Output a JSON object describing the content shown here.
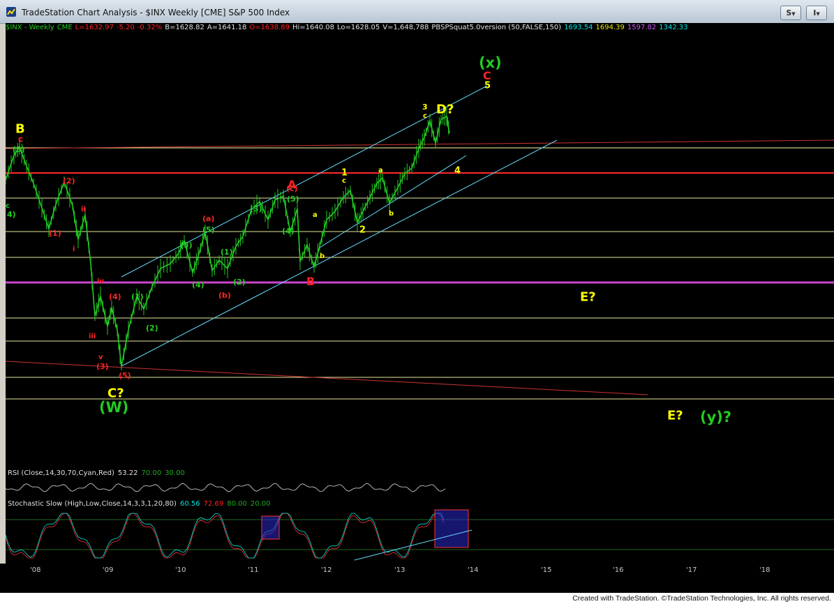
{
  "window": {
    "title": "TradeStation Chart Analysis - $INX Weekly [CME] S&P 500 Index",
    "buttons": [
      {
        "label": "S"
      },
      {
        "label": "I"
      }
    ]
  },
  "status_bar": {
    "symbol": "$INX - Weekly",
    "exchange": "CME",
    "last": "L=1632.97",
    "change": "-5.20",
    "pct_change": "-0.32%",
    "bid": "B=1628.82",
    "ask": "A=1641.18",
    "open": "O=1638.89",
    "high": "Hi=1640.08",
    "low": "Lo=1628.05",
    "volume": "V=1,648,788",
    "indicator": "PBSPSquat5.0version (50,FALSE,150)",
    "values": [
      "1693.54",
      "1694.39",
      "1597.82",
      "1342.33"
    ],
    "value_colors": [
      "#00e5e5",
      "#e5e500",
      "#cc55ee",
      "#00e5e5"
    ]
  },
  "rsi": {
    "label": "RSI (Close,14,30,70,Cyan,Red)",
    "value": "53.22",
    "upper": "70.00",
    "lower": "30.00"
  },
  "stochastic": {
    "label": "Stochastic Slow (High,Low,Close,14,3,3,1,20,80)",
    "k": "60.56",
    "d": "72.69",
    "upper": "80.00",
    "lower": "20.00"
  },
  "x_axis": {
    "ticks": [
      "'08",
      "'09",
      "'10",
      "'11",
      "'12",
      "'13",
      "'14",
      "'15",
      "'16",
      "'17",
      "'18"
    ]
  },
  "wave_labels": [
    {
      "t": "B",
      "c": "#ffff00",
      "s": 18
    },
    {
      "t": "c",
      "c": "#ff2222",
      "s": 12
    },
    {
      "t": "(5)",
      "c": "#22cc22",
      "s": 11
    },
    {
      "t": "c",
      "c": "#22cc22",
      "s": 10
    },
    {
      "t": "4)",
      "c": "#22cc22",
      "s": 11
    },
    {
      "t": "(2)",
      "c": "#ff2222",
      "s": 11
    },
    {
      "t": "(1)",
      "c": "#ff2222",
      "s": 11
    },
    {
      "t": "ii",
      "c": "#ff2222",
      "s": 10
    },
    {
      "t": "i",
      "c": "#ff2222",
      "s": 10
    },
    {
      "t": "iv",
      "c": "#ff2222",
      "s": 10
    },
    {
      "t": "(4)",
      "c": "#ff2222",
      "s": 11
    },
    {
      "t": "iii",
      "c": "#ff2222",
      "s": 10
    },
    {
      "t": "v",
      "c": "#ff2222",
      "s": 10
    },
    {
      "t": "(3)",
      "c": "#ff2222",
      "s": 11
    },
    {
      "t": "(5)",
      "c": "#ff2222",
      "s": 11
    },
    {
      "t": "C?",
      "c": "#ffff00",
      "s": 18
    },
    {
      "t": "(W)",
      "c": "#22cc22",
      "s": 21
    },
    {
      "t": "(1)",
      "c": "#22cc22",
      "s": 11
    },
    {
      "t": "(2)",
      "c": "#22cc22",
      "s": 11
    },
    {
      "t": "(3)",
      "c": "#22cc22",
      "s": 11
    },
    {
      "t": "(4)",
      "c": "#22cc22",
      "s": 11
    },
    {
      "t": "(a)",
      "c": "#ff2222",
      "s": 11
    },
    {
      "t": "(5)",
      "c": "#22cc22",
      "s": 11
    },
    {
      "t": "(1)",
      "c": "#22cc22",
      "s": 11
    },
    {
      "t": "(b)",
      "c": "#ff2222",
      "s": 11
    },
    {
      "t": "(2)",
      "c": "#22cc22",
      "s": 11
    },
    {
      "t": "(3)",
      "c": "#22cc22",
      "s": 11
    },
    {
      "t": "A",
      "c": "#ff2222",
      "s": 16
    },
    {
      "t": "(c)",
      "c": "#ff2222",
      "s": 11
    },
    {
      "t": "(5)",
      "c": "#22cc22",
      "s": 11
    },
    {
      "t": "(4)",
      "c": "#22cc22",
      "s": 11
    },
    {
      "t": "B",
      "c": "#ff2222",
      "s": 16
    },
    {
      "t": "a",
      "c": "#ffff00",
      "s": 10
    },
    {
      "t": "b",
      "c": "#ffff00",
      "s": 10
    },
    {
      "t": "1",
      "c": "#ffff00",
      "s": 13
    },
    {
      "t": "c",
      "c": "#ffff00",
      "s": 10
    },
    {
      "t": "2",
      "c": "#ffff00",
      "s": 13
    },
    {
      "t": "a",
      "c": "#ffff00",
      "s": 10
    },
    {
      "t": "b",
      "c": "#ffff00",
      "s": 10
    },
    {
      "t": "3",
      "c": "#ffff00",
      "s": 11
    },
    {
      "t": "c",
      "c": "#ffff00",
      "s": 10
    },
    {
      "t": "D?",
      "c": "#ffff00",
      "s": 18
    },
    {
      "t": "4",
      "c": "#ffff00",
      "s": 13
    },
    {
      "t": "5",
      "c": "#ffff00",
      "s": 13
    },
    {
      "t": "C",
      "c": "#ff2222",
      "s": 16
    },
    {
      "t": "(x)",
      "c": "#22cc22",
      "s": 21
    },
    {
      "t": "E?",
      "c": "#ffff00",
      "s": 18
    },
    {
      "t": "E?",
      "c": "#ffff00",
      "s": 18
    },
    {
      "t": "(y)?",
      "c": "#22cc22",
      "s": 21
    }
  ],
  "colors": {
    "yellow": "#ffff00",
    "red": "#ff2222",
    "green": "#22cc22",
    "cyan": "#00e5e5",
    "magenta": "#cc55ee",
    "background": "#000000"
  },
  "footer": {
    "text": "Created with TradeStation. ©TradeStation Technologies, Inc. All rights reserved."
  }
}
